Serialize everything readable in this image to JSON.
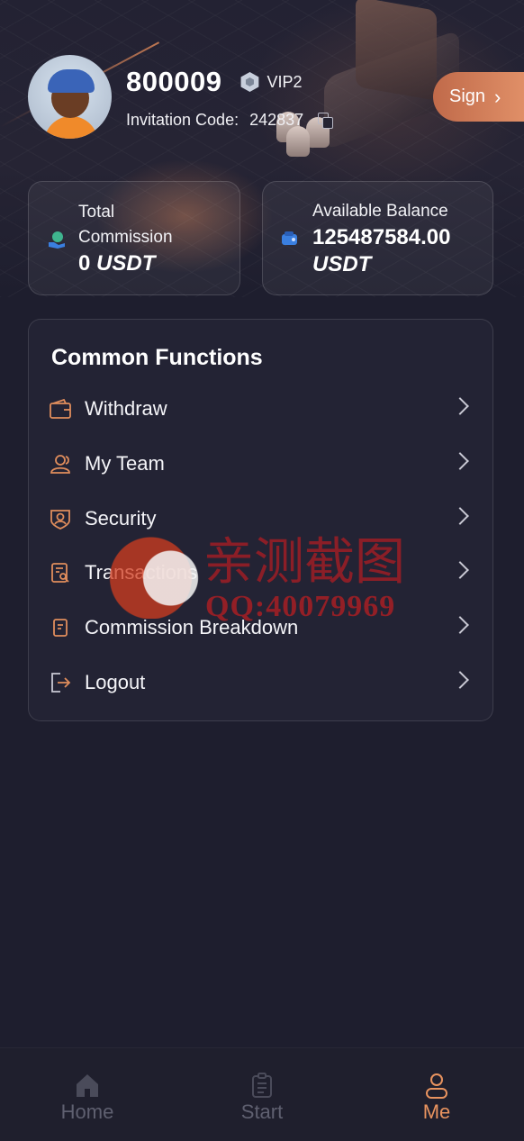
{
  "profile": {
    "user_id": "800009",
    "vip_level": "VIP2",
    "invitation_label": "Invitation Code:",
    "invitation_code": "242837"
  },
  "sign_button": {
    "label": "Sign"
  },
  "stats": {
    "total_commission": {
      "label_line1": "Total",
      "label_line2": "Commission",
      "amount": "0",
      "unit": "USDT"
    },
    "available_balance": {
      "label": "Available Balance",
      "amount": "125487584.00",
      "unit": "USDT"
    }
  },
  "functions": {
    "title": "Common Functions",
    "items": [
      {
        "label": "Withdraw",
        "icon": "wallet-icon"
      },
      {
        "label": "My Team",
        "icon": "team-icon"
      },
      {
        "label": "Security",
        "icon": "shield-user-icon"
      },
      {
        "label": "Transactions",
        "icon": "document-search-icon"
      },
      {
        "label": "Commission Breakdown",
        "icon": "document-icon"
      },
      {
        "label": "Logout",
        "icon": "logout-icon"
      }
    ]
  },
  "watermark": {
    "cn_text": "亲测截图",
    "qq_text": "QQ:40079969"
  },
  "tabbar": {
    "tabs": [
      {
        "label": "Home",
        "icon": "home-icon",
        "active": false
      },
      {
        "label": "Start",
        "icon": "clipboard-icon",
        "active": false
      },
      {
        "label": "Me",
        "icon": "user-icon",
        "active": true
      }
    ]
  },
  "colors": {
    "accent": "#e8935f",
    "background": "#1e1e2e",
    "card": "#232334",
    "inactive": "#5f6070"
  }
}
